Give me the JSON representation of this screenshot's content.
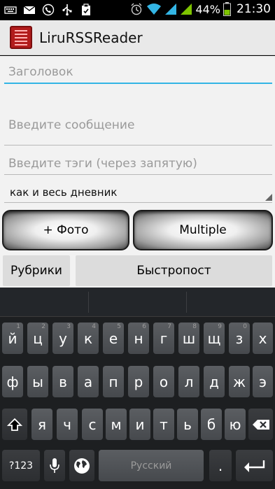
{
  "status_bar": {
    "battery_percent": "44%",
    "time": "21:30"
  },
  "app_bar": {
    "title": "LiruRSSReader"
  },
  "form": {
    "title_placeholder": "Заголовок",
    "message_placeholder": "Введите сообщение",
    "tags_placeholder": "Введите тэги (через запятую)",
    "visibility_value": "как и весь дневник"
  },
  "buttons": {
    "photo": "+ Фото",
    "multiple": "Multiple",
    "rubrics": "Рубрики",
    "quick_post": "Быстропост"
  },
  "keyboard": {
    "row1": [
      {
        "key": "й",
        "hint": "1"
      },
      {
        "key": "ц",
        "hint": "2"
      },
      {
        "key": "у",
        "hint": "3"
      },
      {
        "key": "к",
        "hint": "4"
      },
      {
        "key": "е",
        "hint": "5"
      },
      {
        "key": "н",
        "hint": "6"
      },
      {
        "key": "г",
        "hint": "7"
      },
      {
        "key": "ш",
        "hint": "8"
      },
      {
        "key": "щ",
        "hint": "9"
      },
      {
        "key": "з",
        "hint": "0"
      },
      {
        "key": "х",
        "hint": ""
      }
    ],
    "row2": [
      "ф",
      "ы",
      "в",
      "а",
      "п",
      "р",
      "о",
      "л",
      "д",
      "ж",
      "э"
    ],
    "row3": [
      "я",
      "ч",
      "с",
      "м",
      "и",
      "т",
      "ь",
      "б",
      "ю"
    ],
    "symbols_label": "?123",
    "space_label": "Русский",
    "period_label": ".",
    "icons": {
      "shift": "shift-icon",
      "backspace": "backspace-icon",
      "mic": "mic-icon",
      "globe": "globe-icon",
      "enter": "enter-icon"
    }
  },
  "colors": {
    "accent": "#33b5e5",
    "battery_green": "#7ec400",
    "app_icon_red": "#b21c1c"
  }
}
